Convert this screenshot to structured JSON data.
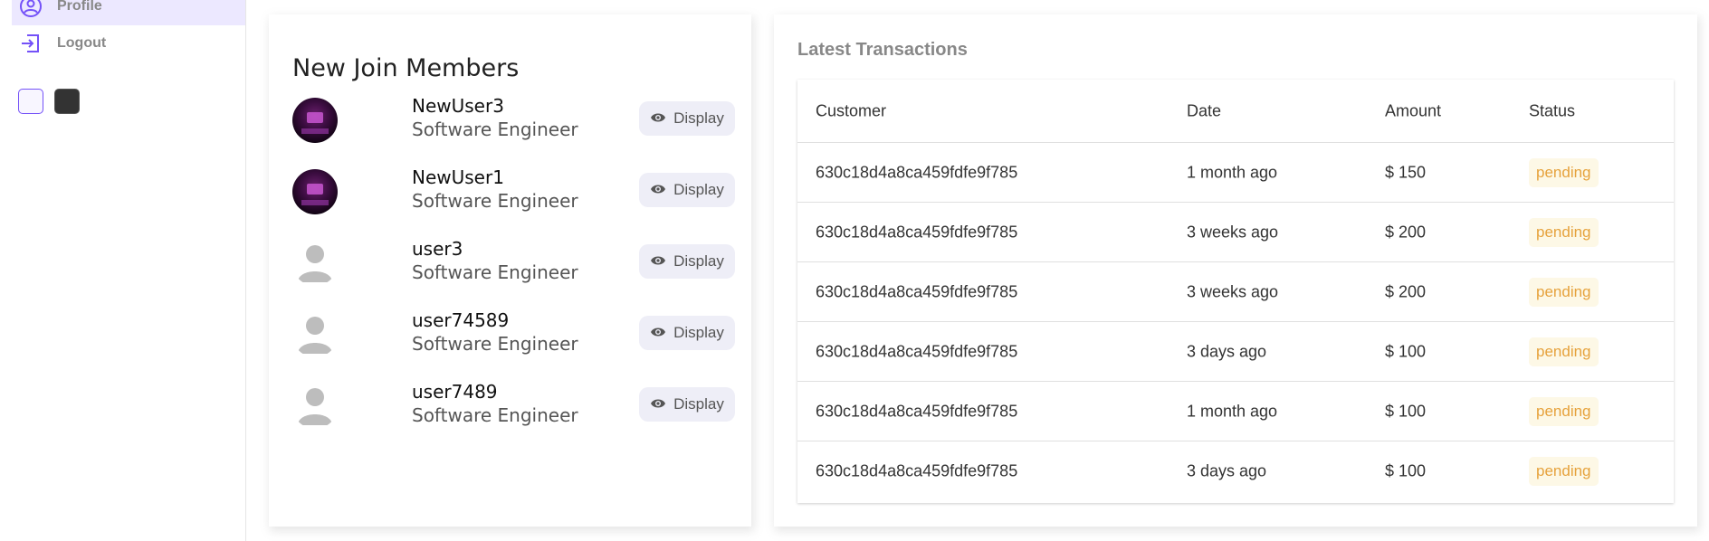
{
  "sidebar": {
    "items": [
      {
        "label": "Profile",
        "icon": "account-circle-icon"
      },
      {
        "label": "Logout",
        "icon": "logout-icon"
      }
    ],
    "theme": {
      "light": "light-theme",
      "dark": "dark-theme"
    }
  },
  "members_widget": {
    "title": "New Join Members",
    "members": [
      {
        "name": "NewUser3",
        "title": "Software Engineer",
        "avatar": "image",
        "button": "Display"
      },
      {
        "name": "NewUser1",
        "title": "Software Engineer",
        "avatar": "image",
        "button": "Display"
      },
      {
        "name": "user3",
        "title": "Software Engineer",
        "avatar": "default",
        "button": "Display"
      },
      {
        "name": "user74589",
        "title": "Software Engineer",
        "avatar": "default",
        "button": "Display"
      },
      {
        "name": "user7489",
        "title": "Software Engineer",
        "avatar": "default",
        "button": "Display"
      }
    ]
  },
  "transactions": {
    "title": "Latest Transactions",
    "columns": [
      "Customer",
      "Date",
      "Amount",
      "Status"
    ],
    "rows": [
      {
        "customer": "630c18d4a8ca459fdfe9f785",
        "date": "1 month ago",
        "amount": "$ 150",
        "status": "pending"
      },
      {
        "customer": "630c18d4a8ca459fdfe9f785",
        "date": "3 weeks ago",
        "amount": "$ 200",
        "status": "pending"
      },
      {
        "customer": "630c18d4a8ca459fdfe9f785",
        "date": "3 weeks ago",
        "amount": "$ 200",
        "status": "pending"
      },
      {
        "customer": "630c18d4a8ca459fdfe9f785",
        "date": "3 days ago",
        "amount": "$ 100",
        "status": "pending"
      },
      {
        "customer": "630c18d4a8ca459fdfe9f785",
        "date": "1 month ago",
        "amount": "$ 100",
        "status": "pending"
      },
      {
        "customer": "630c18d4a8ca459fdfe9f785",
        "date": "3 days ago",
        "amount": "$ 100",
        "status": "pending"
      }
    ]
  },
  "colors": {
    "accent": "#7451f8",
    "pending_text": "#e6a23c",
    "pending_bg": "#fdf8e6"
  }
}
